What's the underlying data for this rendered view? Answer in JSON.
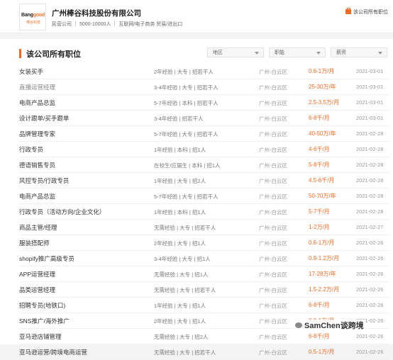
{
  "company": {
    "logo_text_a": "Bang",
    "logo_text_b": "good",
    "logo_sub": "棒谷科技",
    "name": "广州棒谷科技股份有限公司",
    "type": "民营公司",
    "size": "5000-10000人",
    "industry": "互联网/电子商务 贸易/进出口",
    "all_jobs_link": "该公司所有职位"
  },
  "section": {
    "title": "该公司所有职位",
    "filters": [
      {
        "label": "地区"
      },
      {
        "label": "职能"
      },
      {
        "label": "薪资"
      }
    ]
  },
  "jobs": [
    {
      "title": "女装买手",
      "req": "2年经验 | 大专 | 招若干人",
      "loc": "广州-白云区",
      "salary": "0.6-1万/月",
      "date": "2021-03-01"
    },
    {
      "title": "直播运营经理",
      "req": "3-4年经验 | 大专 | 招若干人",
      "loc": "广州-白云区",
      "salary": "25-30万/年",
      "date": "2021-03-01"
    },
    {
      "title": "电商产品总监",
      "req": "5-7年经验 | 本科 | 招若干人",
      "loc": "广州-白云区",
      "salary": "2.5-3.5万/月",
      "date": "2021-03-01"
    },
    {
      "title": "设计跟单/买手跟单",
      "req": "3-4年经验 | 招若干人",
      "loc": "广州-白云区",
      "salary": "6-8千/月",
      "date": "2021-03-01"
    },
    {
      "title": "品牌管理专家",
      "req": "5-7年经验 | 大专 | 招若干人",
      "loc": "广州-白云区",
      "salary": "40-50万/年",
      "date": "2021-02-28"
    },
    {
      "title": "行政专员",
      "req": "1年经验 | 本科 | 招1人",
      "loc": "广州-白云区",
      "salary": "4-6千/月",
      "date": "2021-02-28"
    },
    {
      "title": "德语销售专员",
      "req": "在校生/应届生 | 本科 | 招1人",
      "loc": "广州-白云区",
      "salary": "5-8千/月",
      "date": "2021-02-28"
    },
    {
      "title": "风控专员/行政专员",
      "req": "1年经验 | 大专 | 招2人",
      "loc": "广州-白云区",
      "salary": "4.5-6千/月",
      "date": "2021-02-28"
    },
    {
      "title": "电商产品总监",
      "req": "5-7年经验 | 大专 | 招若干人",
      "loc": "广州-白云区",
      "salary": "50-70万/年",
      "date": "2021-02-28"
    },
    {
      "title": "行政专员（活动方向/企业文化）",
      "req": "1年经验 | 本科 | 招1人",
      "loc": "广州-白云区",
      "salary": "5-7千/月",
      "date": "2021-02-28"
    },
    {
      "title": "商品主管/经理",
      "req": "无需经验 | 大专 | 招若干人",
      "loc": "广州-白云区",
      "salary": "1-2万/月",
      "date": "2021-02-27"
    },
    {
      "title": "服装搭配师",
      "req": "2年经验 | 大专 | 招1人",
      "loc": "广州-白云区",
      "salary": "0.6-1万/月",
      "date": "2021-02-26"
    },
    {
      "title": "shopify推广高级专员",
      "req": "3-4年经验 | 大专 | 招1人",
      "loc": "广州-白云区",
      "salary": "0.9-1.2万/月",
      "date": "2021-02-26"
    },
    {
      "title": "APP运营经理",
      "req": "无需经验 | 大专 | 招1人",
      "loc": "广州-白云区",
      "salary": "17-28万/年",
      "date": "2021-02-26"
    },
    {
      "title": "品类运营经理",
      "req": "无需经验 | 大专 | 招若干人",
      "loc": "广州-白云区",
      "salary": "1.5-2.2万/月",
      "date": "2021-02-26"
    },
    {
      "title": "招聘专员(地铁口)",
      "req": "1年经验 | 大专 | 招1人",
      "loc": "广州-白云区",
      "salary": "6-8千/月",
      "date": "2021-02-26"
    },
    {
      "title": "SNS推广/海外推广",
      "req": "2年经验 | 大专 | 招1人",
      "loc": "广州-白云区",
      "salary": "0.8-1万/月",
      "date": "2021-02-26"
    },
    {
      "title": "亚马逊店铺管理",
      "req": "无需经验 | 大专 | 招2人",
      "loc": "广州-白云区",
      "salary": "6-8千/月",
      "date": "2021-02-26"
    },
    {
      "title": "亚马逊运营/跨境电商运营",
      "req": "无需经验 | 大专 | 招若干人",
      "loc": "广州-白云区",
      "salary": "0.5-1万/月",
      "date": "2021-02-26"
    }
  ],
  "watermark": "SamChen谈跨境"
}
